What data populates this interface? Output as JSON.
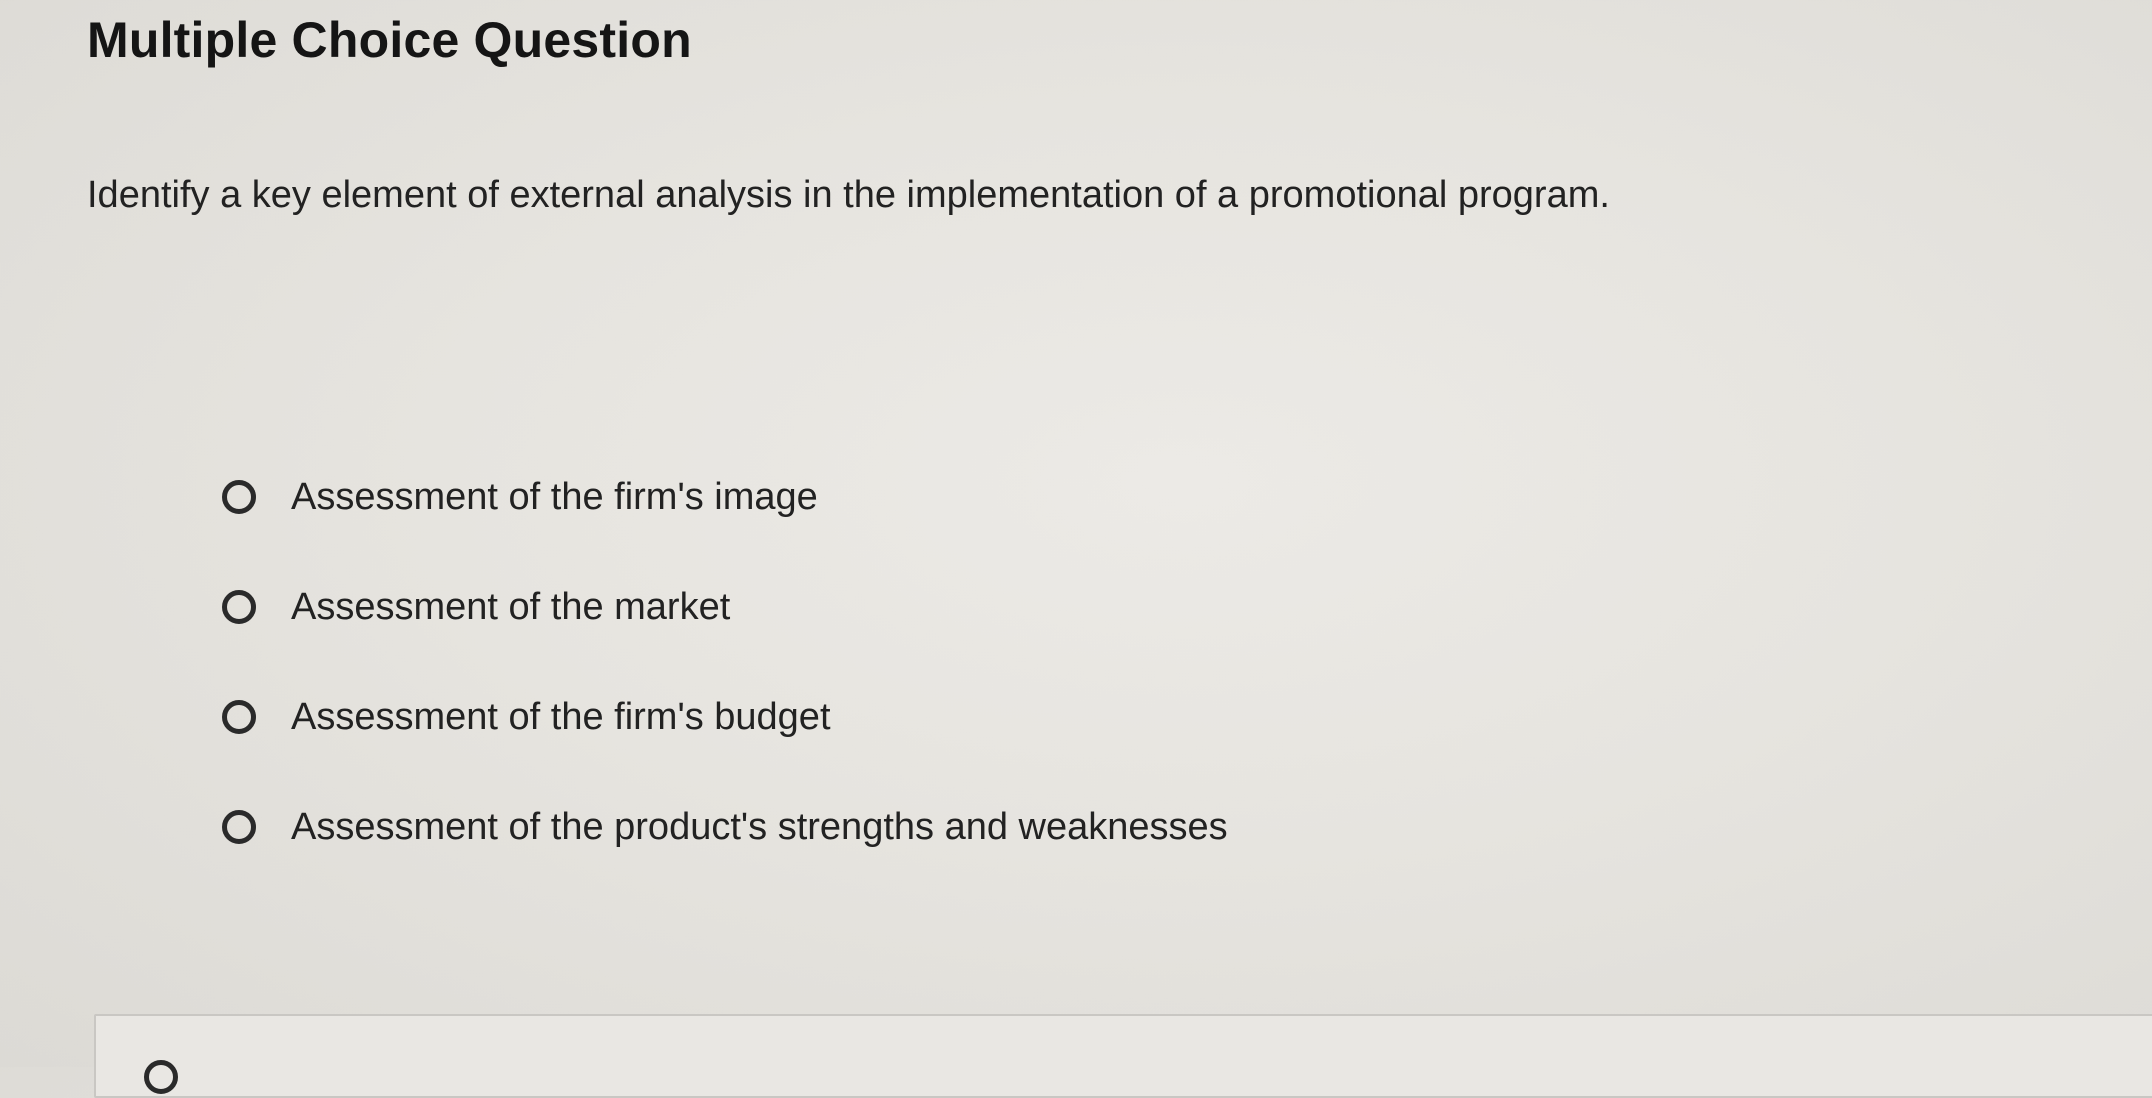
{
  "question": {
    "heading": "Multiple Choice Question",
    "prompt": "Identify a key element of external analysis in the implementation of a promotional program.",
    "options": [
      {
        "label": "Assessment of the firm's image",
        "selected": false
      },
      {
        "label": "Assessment of the market",
        "selected": false
      },
      {
        "label": "Assessment of the firm's budget",
        "selected": false
      },
      {
        "label": "Assessment of the product's strengths and weaknesses",
        "selected": false
      }
    ]
  },
  "colors": {
    "background": "#e6e4df",
    "text": "#222222",
    "radio_border": "#2a2a2a"
  }
}
